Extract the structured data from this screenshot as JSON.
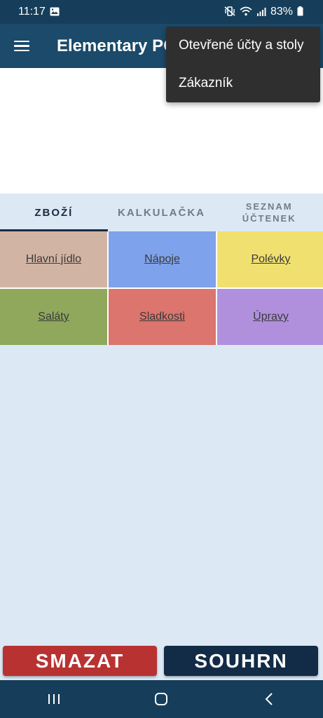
{
  "status_bar": {
    "time": "11:17",
    "battery": "83%",
    "icons": [
      "image-icon",
      "mute-vibrate-icon",
      "wifi-icon",
      "signal-icon",
      "battery-icon"
    ]
  },
  "app_bar": {
    "title": "Elementary POS",
    "icon": "hamburger-menu-icon"
  },
  "dropdown_menu": {
    "items": [
      {
        "label": "Otevřené účty a stoly"
      },
      {
        "label": "Zákazník"
      }
    ]
  },
  "tabs": [
    {
      "label": "ZBOŽÍ",
      "active": true
    },
    {
      "label": "KALKULAČKA",
      "active": false
    },
    {
      "label": "SEZNAM ÚČTENEK",
      "active": false
    }
  ],
  "categories": [
    {
      "label": "Hlavní jídlo",
      "color": "#d2b4a4"
    },
    {
      "label": "Nápoje",
      "color": "#7ea2eb"
    },
    {
      "label": "Polévky",
      "color": "#f0e070"
    },
    {
      "label": "Saláty",
      "color": "#8fa85c"
    },
    {
      "label": "Sladkosti",
      "color": "#db756d"
    },
    {
      "label": "Úpravy",
      "color": "#b090dc"
    }
  ],
  "actions": {
    "delete_label": "SMAZAT",
    "summary_label": "SOUHRN"
  },
  "nav_bar": {
    "icons": [
      "recent-apps-icon",
      "home-icon",
      "back-icon"
    ]
  },
  "colors": {
    "app_bar": "#1b4a6a",
    "background": "#dce9f5",
    "delete": "#b83232",
    "summary": "#122b46"
  }
}
